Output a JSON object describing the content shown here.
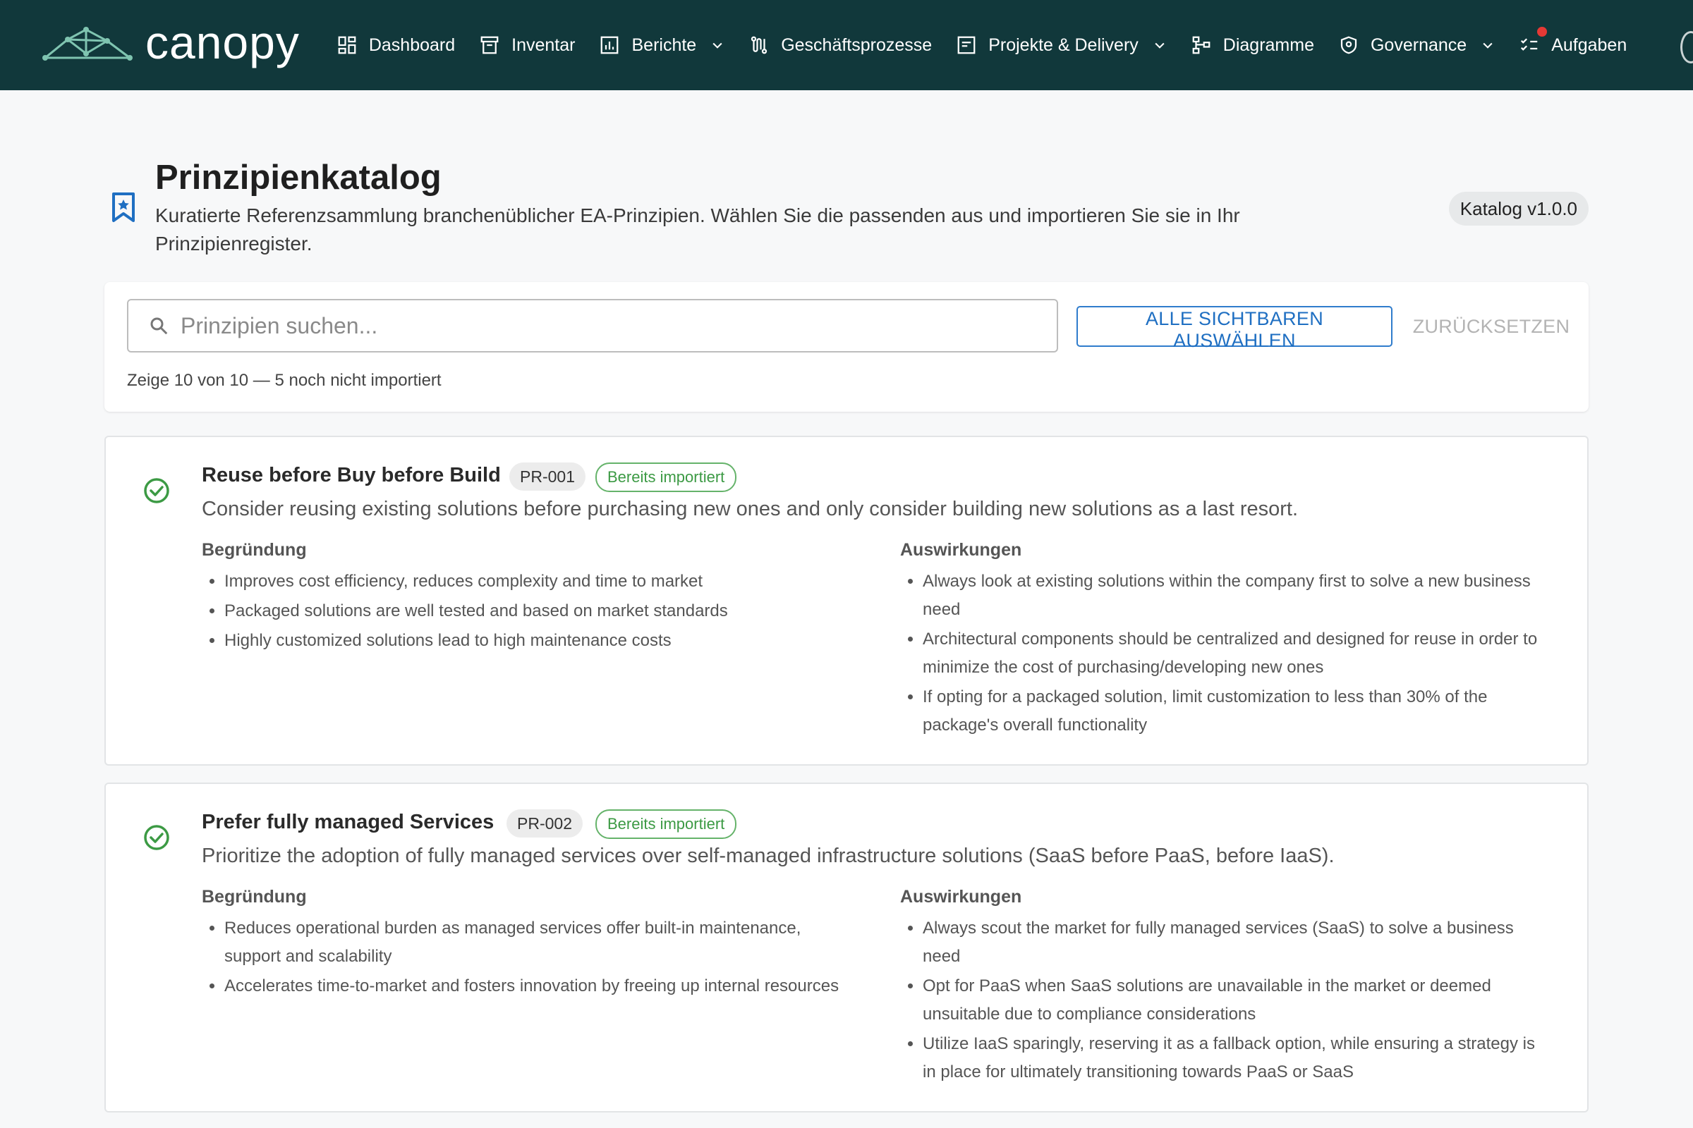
{
  "brand": {
    "name": "canopy"
  },
  "nav": {
    "items": [
      {
        "label": "Dashboard",
        "icon": "dashboard-icon"
      },
      {
        "label": "Inventar",
        "icon": "archive-icon"
      },
      {
        "label": "Berichte",
        "icon": "bar-chart-icon",
        "dropdown": true
      },
      {
        "label": "Geschäftsprozesse",
        "icon": "route-icon"
      },
      {
        "label": "Projekte & Delivery",
        "icon": "project-icon",
        "dropdown": true
      },
      {
        "label": "Diagramme",
        "icon": "diagram-icon"
      },
      {
        "label": "Governance",
        "icon": "shield-icon",
        "dropdown": true
      },
      {
        "label": "Aufgaben",
        "icon": "checklist-icon",
        "notification": true
      }
    ]
  },
  "header": {
    "title": "Prinzipienkatalog",
    "description": "Kuratierte Referenzsammlung branchenüblicher EA-Prinzipien. Wählen Sie die passenden aus und importieren Sie sie in Ihr Prinzipienregister.",
    "version": "Katalog v1.0.0"
  },
  "search": {
    "placeholder": "Prinzipien suchen...",
    "value": "",
    "select_all_label": "ALLE SICHTBAREN AUSWÄHLEN",
    "reset_label": "ZURÜCKSETZEN",
    "status": "Zeige 10 von 10 — 5 noch nicht importiert"
  },
  "principles": [
    {
      "title": "Reuse before Buy before Build",
      "code": "PR-001",
      "status": "Bereits importiert",
      "description": "Consider reusing existing solutions before purchasing new ones and only consider building new solutions as a last resort.",
      "rationale_label": "Begründung",
      "implications_label": "Auswirkungen",
      "rationale": [
        "Improves cost efficiency, reduces complexity and time to market",
        "Packaged solutions are well tested and based on market standards",
        "Highly customized solutions lead to high maintenance costs"
      ],
      "implications": [
        "Always look at existing solutions within the company first to solve a new business need",
        "Architectural components should be centralized and designed for reuse in order to minimize the cost of purchasing/developing new ones",
        "If opting for a packaged solution, limit customization to less than 30% of the package's overall functionality"
      ]
    },
    {
      "title": "Prefer fully managed Services",
      "code": "PR-002",
      "status": "Bereits importiert",
      "description": "Prioritize the adoption of fully managed services over self-managed infrastructure solutions (SaaS before PaaS, before IaaS).",
      "rationale_label": "Begründung",
      "implications_label": "Auswirkungen",
      "rationale": [
        "Reduces operational burden as managed services offer built-in maintenance, support and scalability",
        "Accelerates time-to-market and fosters innovation by freeing up internal resources"
      ],
      "implications": [
        "Always scout the market for fully managed services (SaaS) to solve a business need",
        "Opt for PaaS when SaaS solutions are unavailable in the market or deemed unsuitable due to compliance considerations",
        "Utilize IaaS sparingly, reserving it as a fallback option, while ensuring a strategy is in place for ultimately transitioning towards PaaS or SaaS"
      ]
    }
  ],
  "colors": {
    "topbar": "#11383b",
    "accent_blue": "#1f6fc2",
    "imported_green": "#3c9a44",
    "notification_red": "#e53935"
  }
}
